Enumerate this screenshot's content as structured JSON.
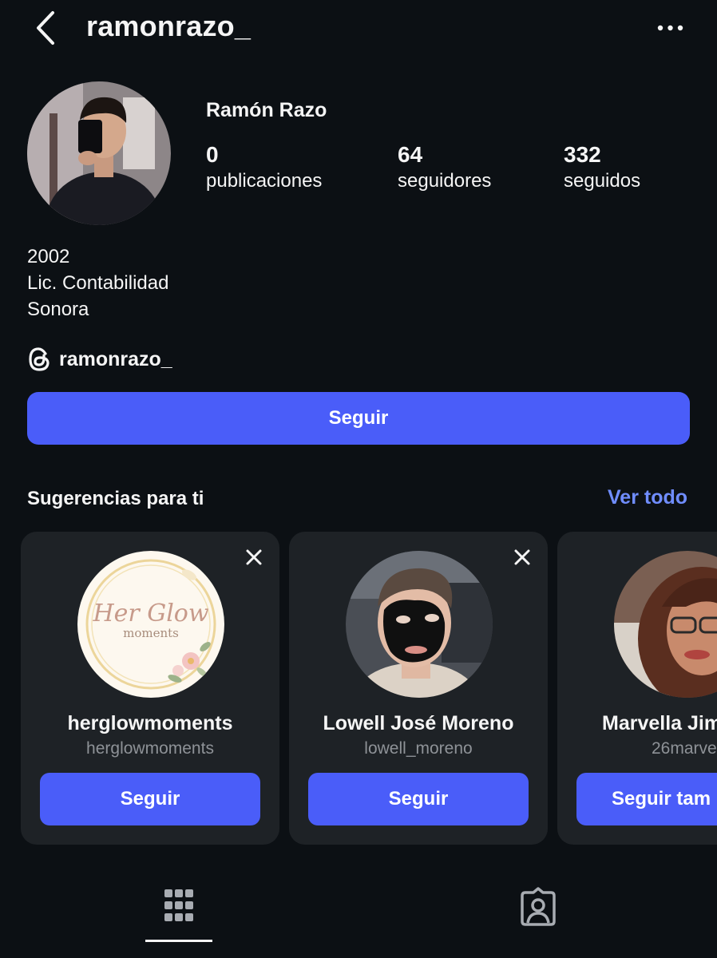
{
  "header": {
    "back_icon": "chevron-left-icon",
    "username": "ramonrazo_",
    "more_icon": "more-horizontal-icon"
  },
  "profile": {
    "display_name": "Ramón Razo",
    "stats": [
      {
        "value": "0",
        "label": "publicaciones"
      },
      {
        "value": "64",
        "label": "seguidores"
      },
      {
        "value": "332",
        "label": "seguidos"
      }
    ],
    "bio": [
      "2002",
      "Lic. Contabilidad",
      "Sonora"
    ],
    "threads_handle": "ramonrazo_",
    "follow_label": "Seguir"
  },
  "suggestions": {
    "title": "Sugerencias para ti",
    "see_all": "Ver todo",
    "cards": [
      {
        "name": "herglowmoments",
        "username": "herglowmoments",
        "button": "Seguir",
        "logo_text": [
          "Her Glow",
          "moments"
        ]
      },
      {
        "name": "Lowell José Moreno",
        "username": "lowell_moreno",
        "button": "Seguir"
      },
      {
        "name": "Marvella Jim",
        "username": "26marve",
        "button": "Seguir tam"
      }
    ]
  },
  "tabs": [
    {
      "icon": "grid-icon",
      "selected": true
    },
    {
      "icon": "tagged-icon",
      "selected": false
    }
  ],
  "colors": {
    "background": "#0c1014",
    "card": "#1e2226",
    "accent": "#4a5df9",
    "link": "#708dff",
    "secondary_text": "#8e9297"
  }
}
